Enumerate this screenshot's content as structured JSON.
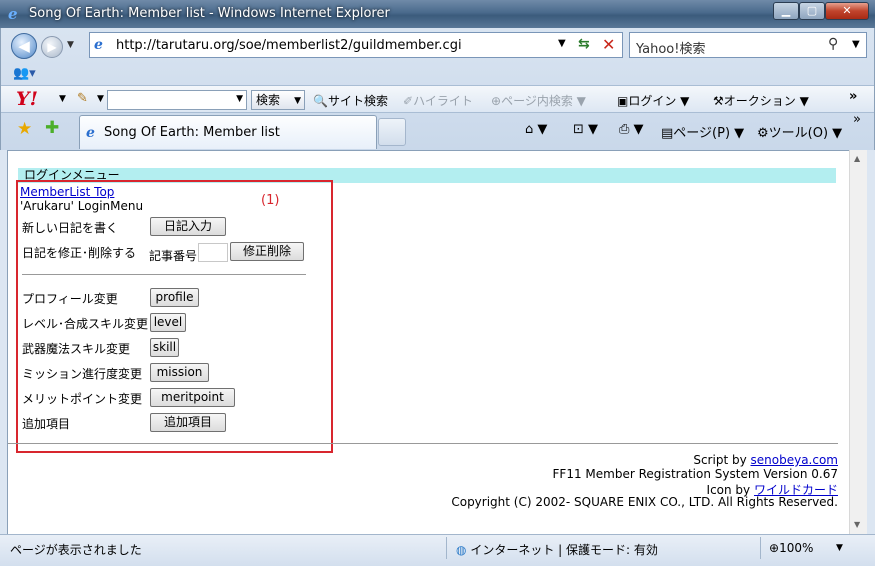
{
  "window": {
    "title": "Song Of Earth: Member list - Windows Internet Explorer",
    "min_glyph": "▁",
    "max_glyph": "▢",
    "close_glyph": "✕"
  },
  "address": {
    "url": "http://tarutaru.org/soe/memberlist2/guildmember.cgi"
  },
  "search": {
    "placeholder": "Yahoo!検索"
  },
  "yahoo_toolbar": {
    "logo": "Y!",
    "search_button": "検索",
    "site_search": "サイト検索",
    "highlight": "ハイライト",
    "page_search": "ページ内検索",
    "login": "ログイン",
    "auction": "オークション"
  },
  "tab": {
    "label": "Song Of Earth: Member list"
  },
  "command_bar": {
    "page": "ページ(P)",
    "tools": "ツール(O)"
  },
  "page": {
    "login_menu_header": "ログインメニュー",
    "memberlist_top": "MemberList Top",
    "login_menu_label": "'Arukaru' LoginMenu",
    "annotation": "(1)",
    "diary_new_label": "新しい日記を書く",
    "diary_new_button": "日記入力",
    "diary_edit_label": "日記を修正･削除する",
    "article_number_label": "記事番号",
    "diary_edit_button": "修正削除",
    "rows": [
      {
        "label": "プロフィール変更",
        "button": "profile"
      },
      {
        "label": "レベル･合成スキル変更",
        "button": "level"
      },
      {
        "label": "武器魔法スキル変更",
        "button": "skill"
      },
      {
        "label": "ミッション進行度変更",
        "button": "mission"
      },
      {
        "label": "メリットポイント変更",
        "button": "meritpoint"
      },
      {
        "label": "追加項目",
        "button": "追加項目"
      }
    ],
    "footer": {
      "script_by": "Script by",
      "script_link": "senobeya.com",
      "system": "FF11 Member Registration System Version 0.67",
      "icon_by": "Icon by",
      "icon_link": "ワイルドカード",
      "copyright": "Copyright (C) 2002- SQUARE ENIX CO., LTD. All Rights Reserved."
    }
  },
  "status": {
    "text": "ページが表示されました",
    "zone": "インターネット | 保護モード: 有効",
    "zoom": "100%"
  }
}
